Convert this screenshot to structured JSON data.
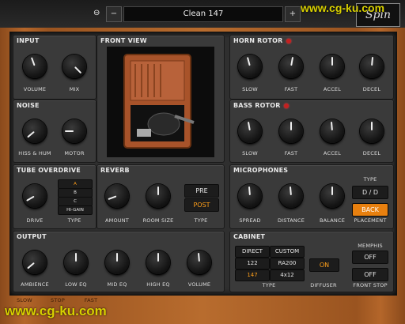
{
  "topbar": {
    "power_icon": "power-icon",
    "prev_label": "−",
    "next_label": "+",
    "preset_name": "Clean 147",
    "logo": "Spin"
  },
  "watermark": "www.cg-ku.com",
  "panels": {
    "input": {
      "title": "INPUT",
      "knobs": [
        "VOLUME",
        "MIX"
      ]
    },
    "front_view": {
      "title": "FRONT VIEW"
    },
    "horn_rotor": {
      "title": "HORN ROTOR",
      "knobs": [
        "SLOW",
        "FAST",
        "ACCEL",
        "DECEL"
      ]
    },
    "noise": {
      "title": "NOISE",
      "knobs": [
        "HISS & HUM",
        "MOTOR"
      ]
    },
    "bass_rotor": {
      "title": "BASS ROTOR",
      "knobs": [
        "SLOW",
        "FAST",
        "ACCEL",
        "DECEL"
      ]
    },
    "tube_overdrive": {
      "title": "TUBE OVERDRIVE",
      "knob": "DRIVE",
      "type_label": "TYPE",
      "types": [
        "A",
        "B",
        "C",
        "HI-GAIN"
      ],
      "selected_type": "A"
    },
    "reverb": {
      "title": "REVERB",
      "knobs": [
        "AMOUNT",
        "ROOM SIZE"
      ],
      "type_label": "TYPE",
      "types": [
        "PRE",
        "POST"
      ],
      "selected_type": "POST"
    },
    "microphones": {
      "title": "MICROPHONES",
      "knobs": [
        "SPREAD",
        "DISTANCE",
        "BALANCE"
      ],
      "type_label": "TYPE",
      "type_value": "D / D",
      "placement_value": "BACK",
      "placement_label": "PLACEMENT"
    },
    "output": {
      "title": "OUTPUT",
      "knobs": [
        "AMBIENCE",
        "LOW EQ",
        "MID EQ",
        "HIGH EQ",
        "VOLUME"
      ]
    },
    "cabinet": {
      "title": "CABINET",
      "type_options": [
        "DIRECT",
        "CUSTOM",
        "122",
        "RA200",
        "147",
        "4x12"
      ],
      "selected_type": "147",
      "type_label": "TYPE",
      "diffuser_value": "ON",
      "diffuser_label": "DIFFUSER",
      "memphis_label": "MEMPHIS",
      "memphis_value": "OFF",
      "front_stop_value": "OFF",
      "front_stop_label": "FRONT STOP"
    }
  },
  "speed_bar": {
    "labels": [
      "SLOW",
      "STOP",
      "FAST"
    ]
  },
  "colors": {
    "accent": "#ff9f1a",
    "led": "#c42020",
    "panel": "#3a3a3a",
    "wood": "#b4662a"
  }
}
